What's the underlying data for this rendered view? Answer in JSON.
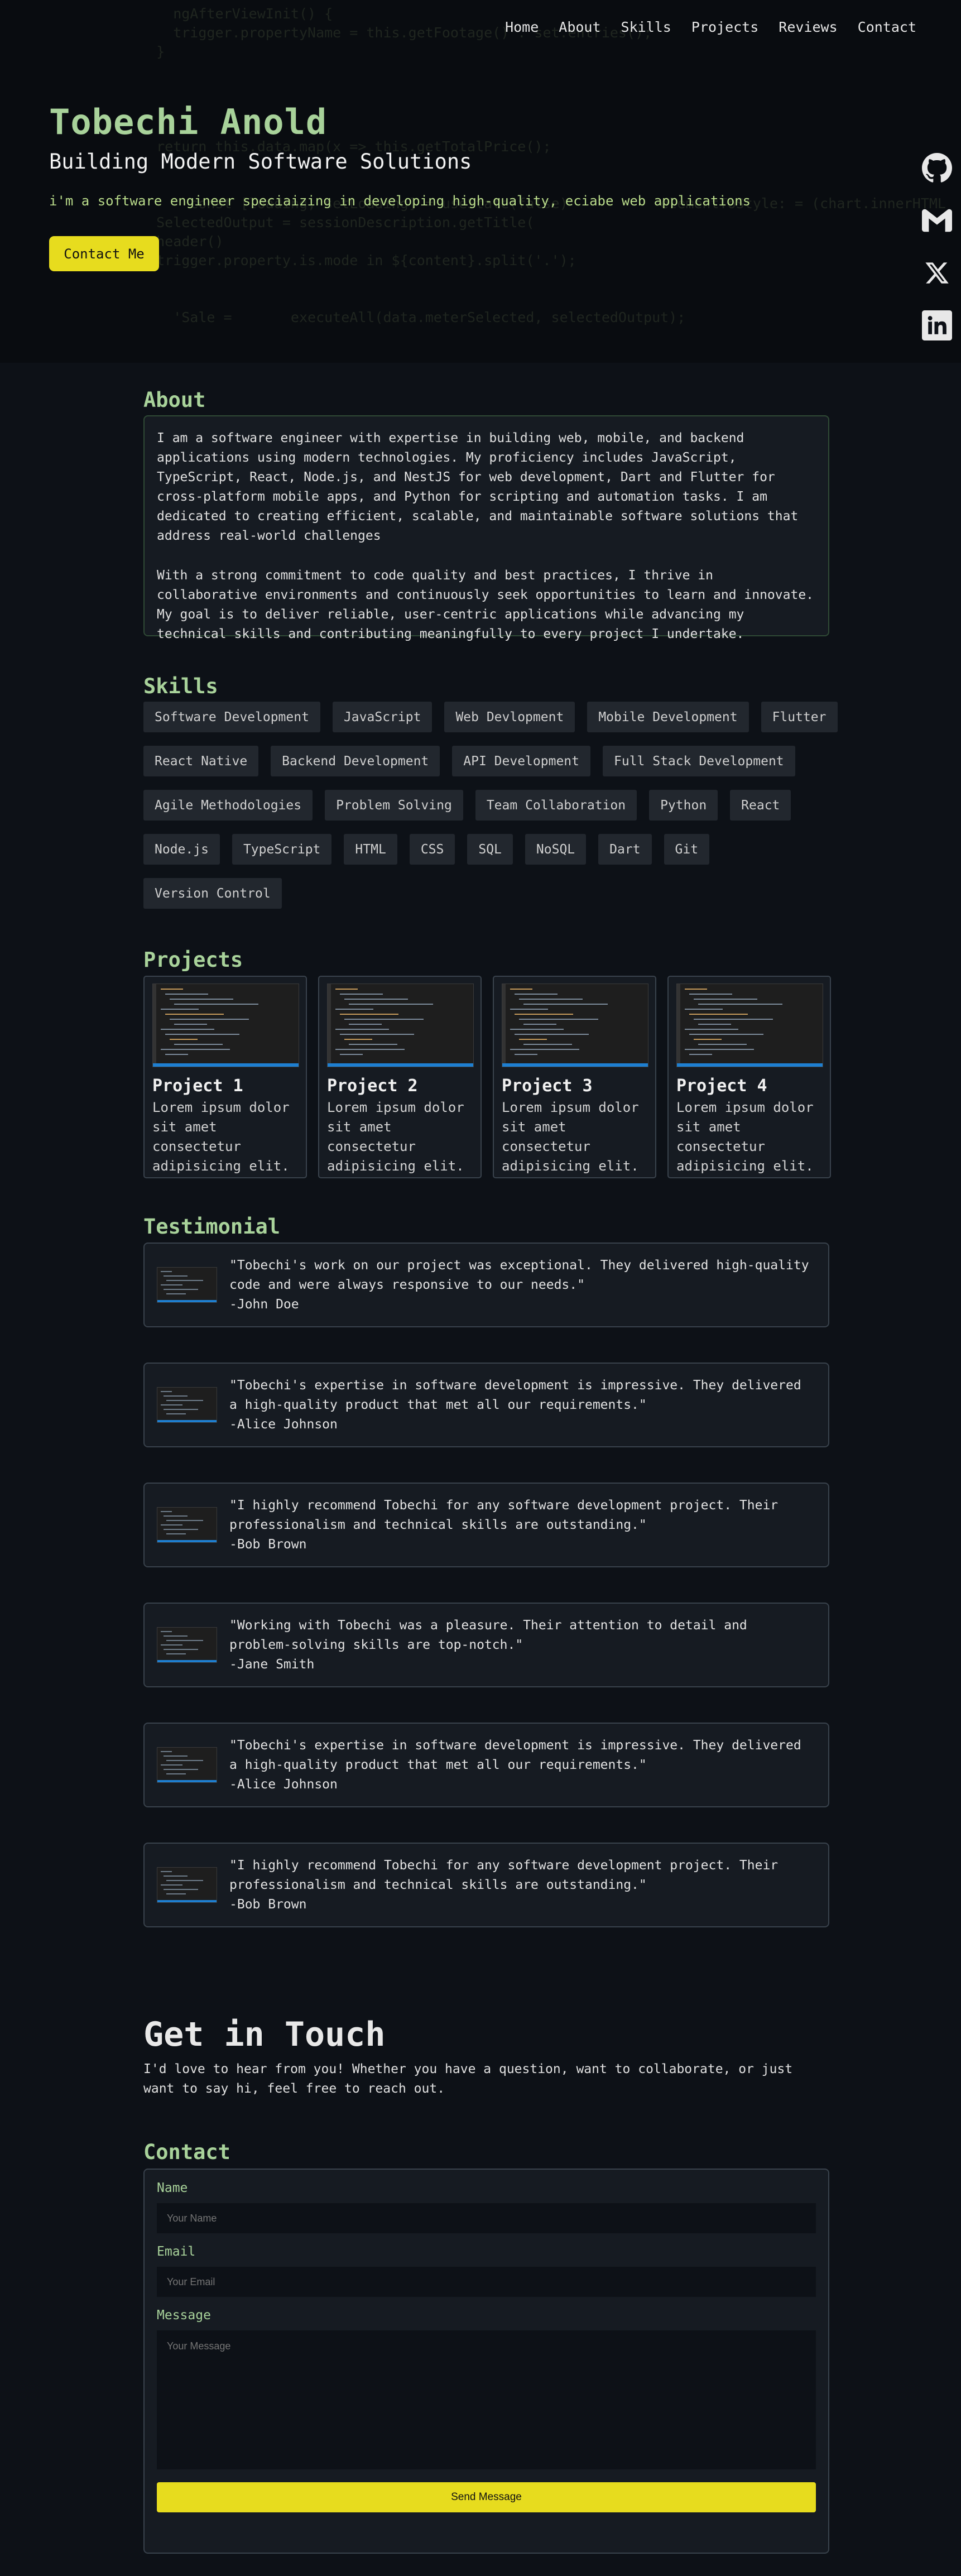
{
  "nav": [
    "Home",
    "About",
    "Skills",
    "Projects",
    "Reviews",
    "Contact"
  ],
  "hero": {
    "name": "Tobechi Anold",
    "subtitle": "Building Modern Software Solutions",
    "tagline": "i'm a software engineer speciaizing in developing high-quality, eciabe web applications",
    "button": "Contact Me",
    "code_background": "    ngAfterViewInit() {\n    trigger.propertyName = this.getFootage() . set.entries();\n  }\n\n\n\n\n  return this.data.map(x => this.getTotalPrice();\n\n\n      const [loading, setLoading] = useState(false)           elementToStyle: = (chart.innerHTML\n  SelectedOutput = sessionDescription.getTitle(\n  header()\n  trigger.property.is.mode in ${content}.split('.');\n\n\n    'Sale =       executeAll(data.meterSelected, selectedOutput);"
  },
  "social_icons": [
    "github-icon",
    "gmail-icon",
    "x-icon",
    "linkedin-icon"
  ],
  "about": {
    "title": "About",
    "p1": "I am a software engineer with expertise in building web, mobile, and backend applications using modern technologies. My proficiency includes JavaScript, TypeScript, React, Node.js, and NestJS for web development, Dart and Flutter for cross-platform mobile apps, and Python for scripting and automation tasks. I am dedicated to creating efficient, scalable, and maintainable software solutions that address real-world challenges",
    "p2": "With a strong commitment to code quality and best practices, I thrive in collaborative environments and continuously seek opportunities to learn and innovate. My goal is to deliver reliable, user-centric applications while advancing my technical skills and contributing meaningfully to every project I undertake."
  },
  "skills": {
    "title": "Skills",
    "items": [
      "Software Development",
      "JavaScript",
      "Web Devlopment",
      "Mobile Development",
      "Flutter",
      "React Native",
      "Backend Development",
      "API Development",
      "Full Stack Development",
      "Agile Methodologies",
      "Problem Solving",
      "Team Collaboration",
      "Python",
      "React",
      "Node.js",
      "TypeScript",
      "HTML",
      "CSS",
      "SQL",
      "NoSQL",
      "Dart",
      "Git",
      "Version Control"
    ]
  },
  "projects": {
    "title": "Projects",
    "items": [
      {
        "title": "Project 1",
        "desc": "Lorem ipsum dolor sit amet consectetur adipisicing elit."
      },
      {
        "title": "Project 2",
        "desc": "Lorem ipsum dolor sit amet consectetur adipisicing elit."
      },
      {
        "title": "Project 3",
        "desc": "Lorem ipsum dolor sit amet consectetur adipisicing elit."
      },
      {
        "title": "Project 4",
        "desc": "Lorem ipsum dolor sit amet consectetur adipisicing elit."
      }
    ]
  },
  "testimonials": {
    "title": "Testimonial",
    "items": [
      {
        "quote": "\"Tobechi's work on our project was exceptional. They delivered high-quality code and were always responsive to our needs.\"",
        "author": "-John Doe"
      },
      {
        "quote": "\"Tobechi's expertise in software development is impressive. They delivered a high-quality product that met all our requirements.\"",
        "author": "-Alice Johnson"
      },
      {
        "quote": "\"I highly recommend Tobechi for any software development project. Their professionalism and technical skills are outstanding.\"",
        "author": "-Bob Brown"
      },
      {
        "quote": "\"Working with Tobechi was a pleasure. Their attention to detail and problem-solving skills are top-notch.\"",
        "author": "-Jane Smith"
      },
      {
        "quote": "\"Tobechi's expertise in software development is impressive. They delivered a high-quality product that met all our requirements.\"",
        "author": "-Alice Johnson"
      },
      {
        "quote": "\"I highly recommend Tobechi for any software development project. Their professionalism and technical skills are outstanding.\"",
        "author": "-Bob Brown"
      }
    ]
  },
  "get_in_touch": {
    "title": "Get in Touch",
    "text": "I'd love to hear from you! Whether you have a question, want to collaborate, or just want to say hi, feel free to reach out."
  },
  "contact": {
    "title": "Contact",
    "name_label": "Name",
    "name_placeholder": "Your Name",
    "email_label": "Email",
    "email_placeholder": "Your Email",
    "message_label": "Message",
    "message_placeholder": "Your Message",
    "send_label": "Send Message"
  },
  "colors": {
    "accent_green": "#a8d29a",
    "accent_yellow": "#e7dc1e",
    "background": "#0d1117",
    "card": "#161b22"
  }
}
